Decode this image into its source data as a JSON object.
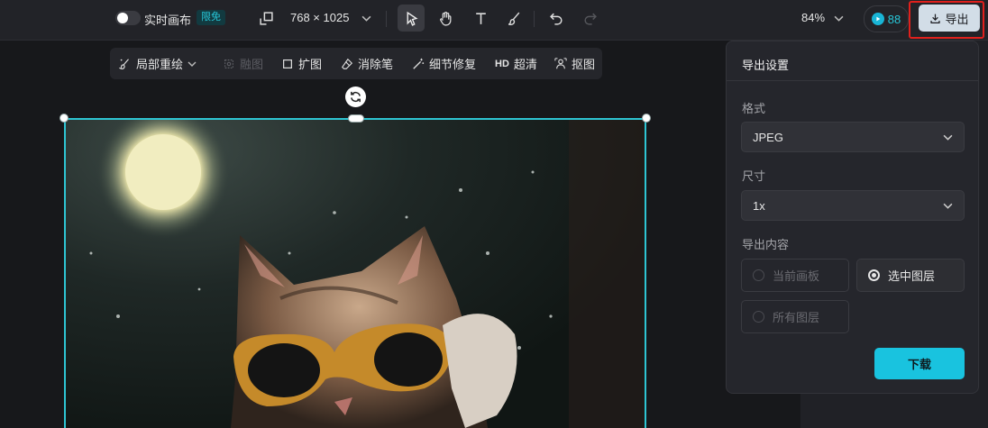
{
  "topbar": {
    "realtime_label": "实时画布",
    "free_badge": "限免",
    "canvas_size": "768 × 1025",
    "zoom": "84%",
    "credits": "88",
    "export_label": "导出"
  },
  "subtoolbar": {
    "items": [
      {
        "label": "局部重绘",
        "enabled": true,
        "icon": "brush-magic-icon"
      },
      {
        "label": "融图",
        "enabled": false,
        "icon": "merge-icon"
      },
      {
        "label": "扩图",
        "enabled": true,
        "icon": "expand-icon"
      },
      {
        "label": "消除笔",
        "enabled": true,
        "icon": "eraser-icon"
      },
      {
        "label": "细节修复",
        "enabled": true,
        "icon": "magic-wand-icon"
      },
      {
        "label": "超清",
        "enabled": true,
        "icon": "hd-icon",
        "prefix": "HD"
      },
      {
        "label": "抠图",
        "enabled": true,
        "icon": "cutout-icon"
      }
    ]
  },
  "export_panel": {
    "title": "导出设置",
    "format_label": "格式",
    "format_value": "JPEG",
    "size_label": "尺寸",
    "size_value": "1x",
    "content_label": "导出内容",
    "options": [
      {
        "label": "当前画板",
        "selected": false,
        "enabled": false
      },
      {
        "label": "选中图层",
        "selected": true,
        "enabled": true
      },
      {
        "label": "所有图层",
        "selected": false,
        "enabled": false
      }
    ],
    "download_label": "下载"
  },
  "colors": {
    "accent": "#19c3df",
    "selection": "#2ec5d3",
    "highlight_box": "#e0201c"
  }
}
